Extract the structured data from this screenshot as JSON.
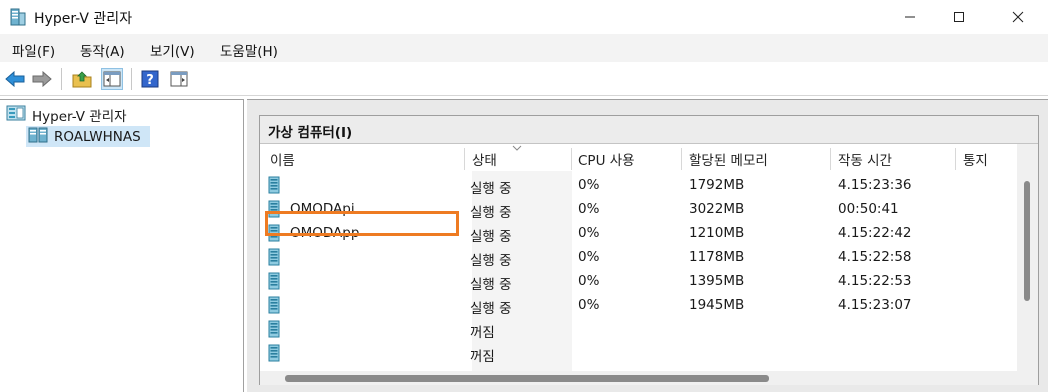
{
  "window": {
    "title": "Hyper-V 관리자",
    "minimize_glyph": "—",
    "maximize_glyph": "☐",
    "close_glyph": "✕"
  },
  "menu": {
    "items": [
      "파일(F)",
      "동작(A)",
      "보기(V)",
      "도움말(H)"
    ]
  },
  "toolbar": {
    "icons": [
      "back-icon",
      "forward-icon",
      "up-folder-icon",
      "show-hide-tree-icon",
      "help-icon",
      "console-icon"
    ]
  },
  "tree": {
    "root_label": "Hyper-V 관리자",
    "child_label": "ROALWHNAS"
  },
  "vm_panel": {
    "title": "가상 컴퓨터(I)",
    "columns": [
      "이름",
      "상태",
      "CPU 사용",
      "할당된 메모리",
      "작동 시간",
      "통지"
    ],
    "rows": [
      {
        "name": "",
        "state": "실행 중",
        "cpu": "0%",
        "memory": "1792MB",
        "uptime": "4.15:23:36"
      },
      {
        "name": "OMODApi",
        "state": "실행 중",
        "cpu": "0%",
        "memory": "3022MB",
        "uptime": "00:50:41"
      },
      {
        "name": "OMODApp",
        "state": "실행 중",
        "cpu": "0%",
        "memory": "1210MB",
        "uptime": "4.15:22:42"
      },
      {
        "name": "",
        "state": "실행 중",
        "cpu": "0%",
        "memory": "1178MB",
        "uptime": "4.15:22:58"
      },
      {
        "name": "",
        "state": "실행 중",
        "cpu": "0%",
        "memory": "1395MB",
        "uptime": "4.15:22:53"
      },
      {
        "name": "",
        "state": "실행 중",
        "cpu": "0%",
        "memory": "1945MB",
        "uptime": "4.15:23:07"
      },
      {
        "name": "",
        "state": "꺼짐",
        "cpu": "",
        "memory": "",
        "uptime": ""
      },
      {
        "name": "",
        "state": "꺼짐",
        "cpu": "",
        "memory": "",
        "uptime": ""
      }
    ]
  },
  "colors": {
    "highlight_border": "#ee7b22",
    "selection_bg": "#cfe6f7",
    "vm_icon": "#3a9bbd"
  }
}
